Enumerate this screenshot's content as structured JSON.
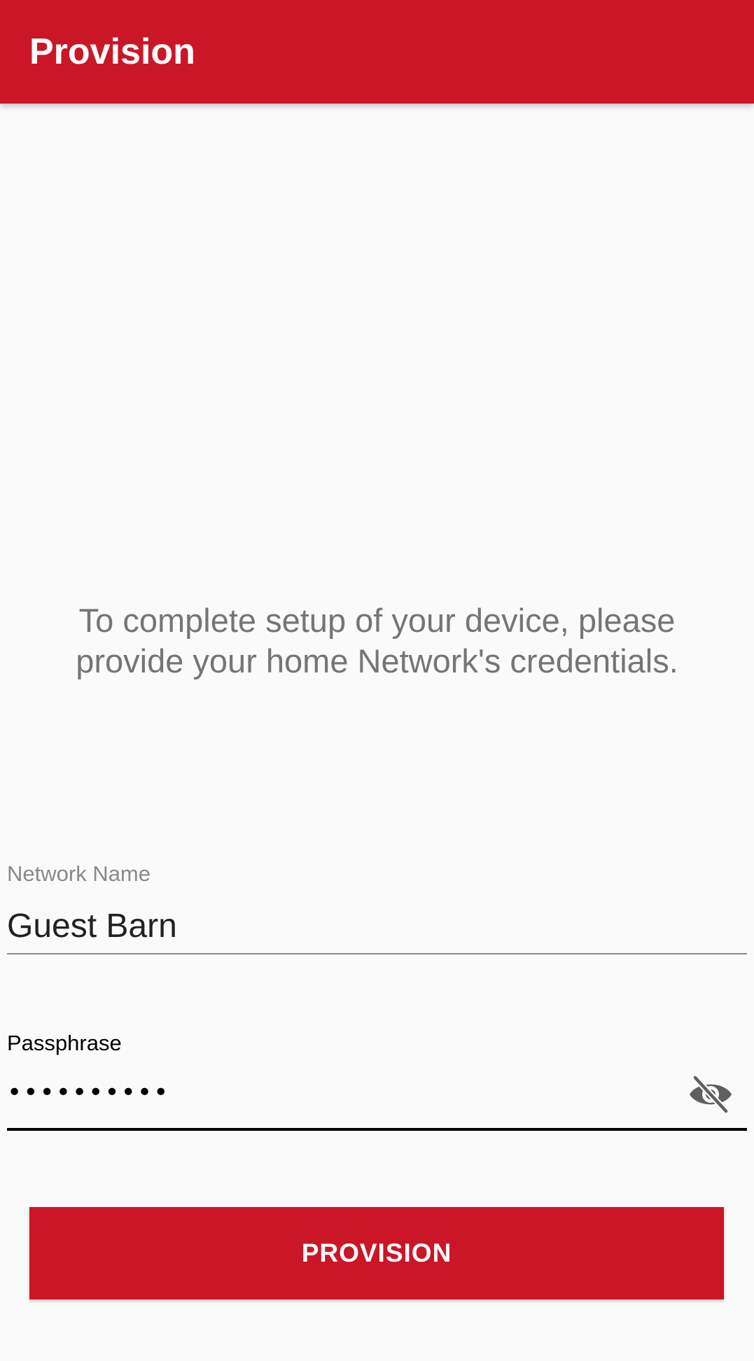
{
  "app_bar": {
    "title": "Provision",
    "background_color": "#cb1628"
  },
  "instructions": {
    "line1": "To complete setup of your device, please",
    "line2": "provide your home Network's credentials."
  },
  "network_name_field": {
    "label": "Network Name",
    "value": "Guest Barn"
  },
  "passphrase_field": {
    "label": "Passphrase",
    "masked_value": "••••••••••",
    "visibility_toggle_icon": "eye-off-icon"
  },
  "provision_button": {
    "label": "PROVISION",
    "color": "#cb1628"
  }
}
